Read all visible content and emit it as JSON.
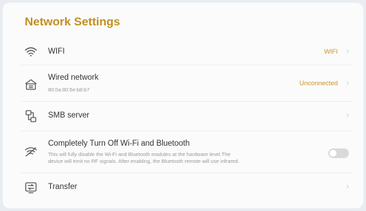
{
  "page": {
    "title": "Network Settings"
  },
  "colors": {
    "accent": "#c79423",
    "background": "#fbfbfc",
    "toggle_off": "#d9d9dc"
  },
  "rows": {
    "wifi": {
      "icon": "wifi-icon",
      "label": "WIFI",
      "value": "WIFI"
    },
    "wired": {
      "icon": "ethernet-icon",
      "label": "Wired network",
      "mac": "80:0a:80:5e:b8:b7",
      "value": "Unconnected"
    },
    "smb": {
      "icon": "smb-server-icon",
      "label": "SMB server"
    },
    "radio_off": {
      "icon": "wireless-off-icon",
      "label": "Completely Turn Off Wi-Fi and Bluetooth",
      "description_line1": "This will fully disable the Wi-Fi and Bluetooth modules at the hardware level.The",
      "description_line2": "device will emit no RF signals. After enabling, the Bluetooth remote will use infrared.",
      "toggle_on": false
    },
    "transfer": {
      "icon": "transfer-icon",
      "label": "Transfer"
    }
  }
}
